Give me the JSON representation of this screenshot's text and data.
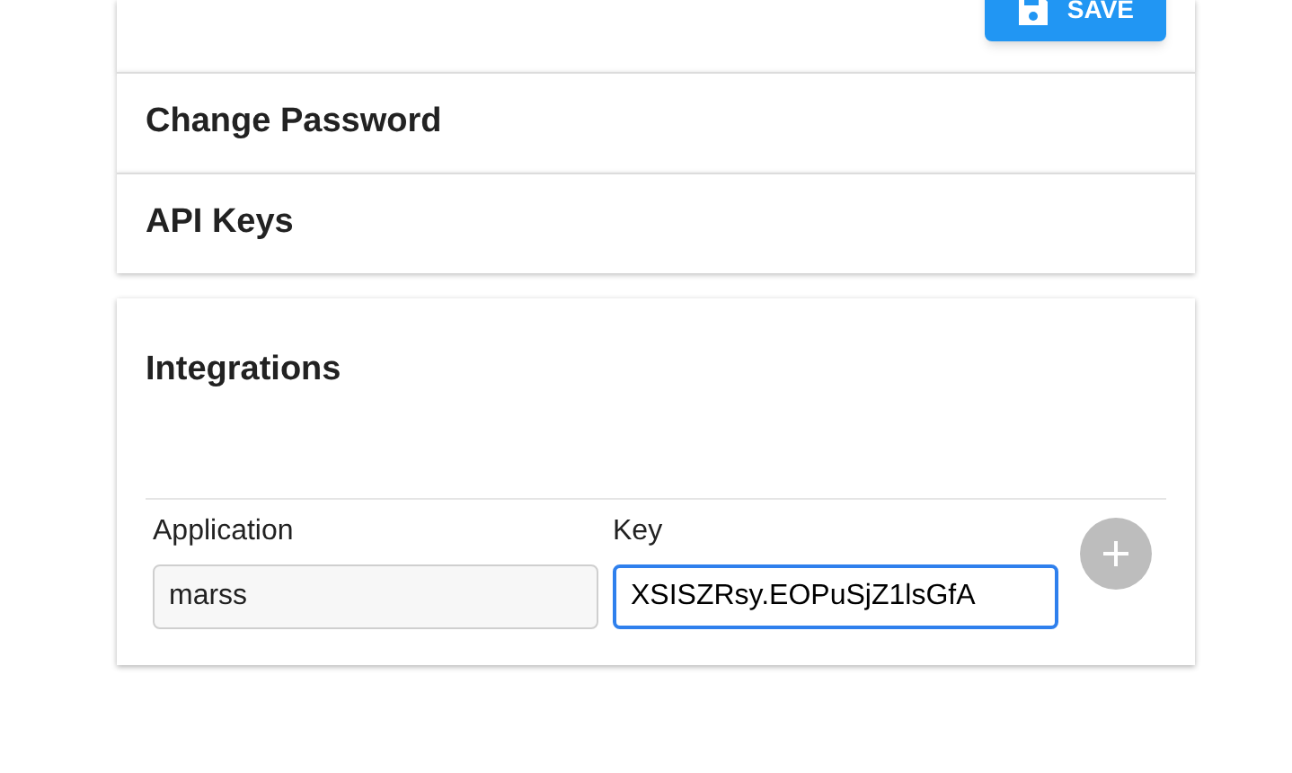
{
  "save_button": {
    "label": "SAVE"
  },
  "panels": [
    {
      "title": "Change Password"
    },
    {
      "title": "API Keys"
    }
  ],
  "integrations": {
    "title": "Integrations",
    "columns": [
      "Application",
      "Key"
    ],
    "fields": [
      {
        "value": "marss",
        "focused": false
      },
      {
        "value": "XSISZRsy.EOPuSjZ1lsGfA",
        "focused": true
      }
    ],
    "add_button": {
      "disabled": true
    }
  }
}
